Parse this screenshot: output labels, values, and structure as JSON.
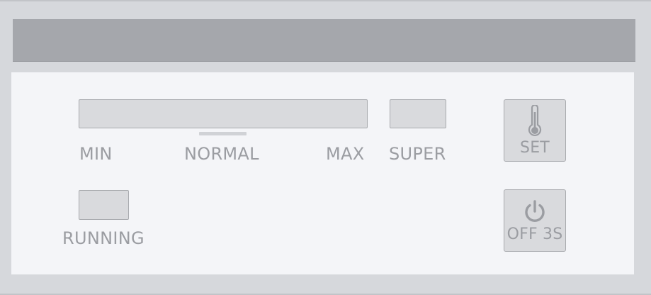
{
  "panel": {
    "labels": {
      "min": "MIN",
      "normal": "NORMAL",
      "max": "MAX",
      "super": "SUPER",
      "running": "RUNNING"
    },
    "buttons": {
      "set": {
        "label": "SET",
        "icon": "thermometer-icon"
      },
      "off": {
        "label": "OFF 3S",
        "icon": "power-icon"
      }
    },
    "colors": {
      "top_bar": "#a5a7ac",
      "panel_bg": "#f4f5f8",
      "indicator_off": "#d9dadd",
      "label_text": "#9b9da2"
    }
  }
}
